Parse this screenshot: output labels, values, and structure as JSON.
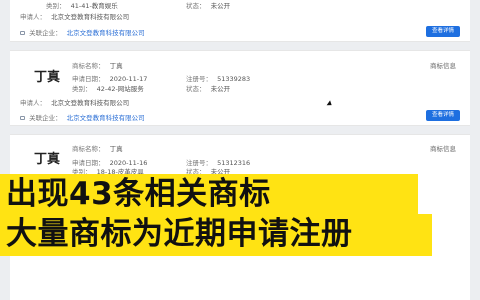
{
  "cards": [
    {
      "mark_name": "",
      "apply_date_label": "",
      "apply_date": "",
      "reg_label": "",
      "reg_no": "",
      "category_label": "类别：",
      "category": "41-41-教育娱乐",
      "status_label": "状态：",
      "status": "未公开",
      "applicant_label": "申请人：",
      "applicant": "北京文登教育科技有限公司",
      "related_label": "关联企业：",
      "related": "北京文登教育科技有限公司",
      "status_tag": "",
      "detail_button": "查看详情"
    },
    {
      "mark_name": "丁真",
      "name_label": "商标名称：",
      "name_value": "丁真",
      "apply_date_label": "申请日期：",
      "apply_date": "2020-11-17",
      "reg_label": "注册号：",
      "reg_no": "51339283",
      "category_label": "类别：",
      "category": "42-42-网站服务",
      "status_label": "状态：",
      "status": "未公开",
      "applicant_label": "申请人：",
      "applicant": "北京文登教育科技有限公司",
      "related_label": "关联企业：",
      "related": "北京文登教育科技有限公司",
      "status_tag": "商标信息",
      "detail_button": "查看详情"
    },
    {
      "mark_name": "丁真",
      "name_label": "商标名称：",
      "name_value": "丁真",
      "apply_date_label": "申请日期：",
      "apply_date": "2020-11-16",
      "reg_label": "注册号：",
      "reg_no": "51312316",
      "category_label": "类别：",
      "category": "18-18-皮革皮具",
      "status_label": "状态：",
      "status": "未公开",
      "status_tag": "商标信息"
    }
  ],
  "caption": {
    "line1": "出现43条相关商标",
    "line2": "大量商标为近期申请注册"
  },
  "colors": {
    "caption_bg": "#ffe313",
    "button_bg": "#1e6fe0",
    "link": "#2b6fd6"
  }
}
